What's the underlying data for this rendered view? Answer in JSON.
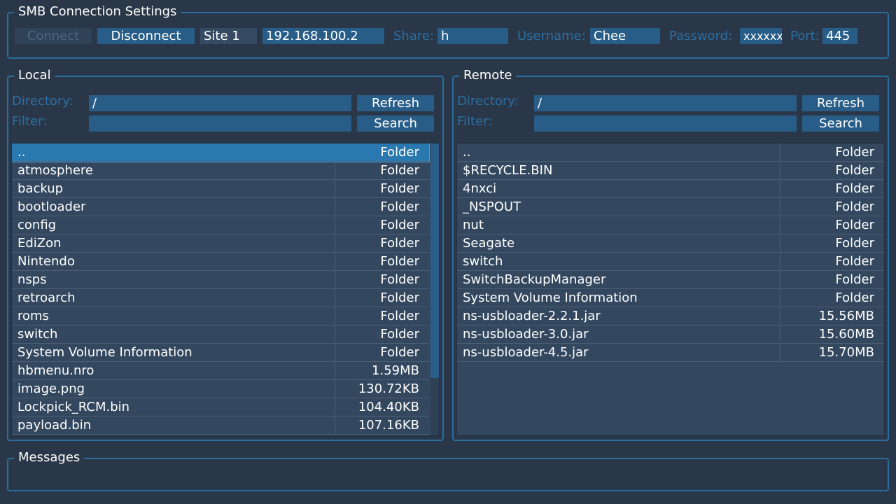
{
  "connection": {
    "title": "SMB Connection Settings",
    "connect_label": "Connect",
    "disconnect_label": "Disconnect",
    "site": "Site 1",
    "host": "192.168.100.2",
    "share_label": "Share:",
    "share": "h",
    "username_label": "Username:",
    "username": "Chee",
    "password_label": "Password:",
    "password": "xxxxxx",
    "port_label": "Port:",
    "port": "445"
  },
  "local": {
    "title": "Local",
    "directory_label": "Directory:",
    "directory": "/",
    "filter_label": "Filter:",
    "filter": "",
    "refresh_label": "Refresh",
    "search_label": "Search",
    "scroll_fraction_visible": 0.8,
    "files": [
      {
        "name": "..",
        "size": "Folder",
        "selected": true
      },
      {
        "name": "atmosphere",
        "size": "Folder"
      },
      {
        "name": "backup",
        "size": "Folder"
      },
      {
        "name": "bootloader",
        "size": "Folder"
      },
      {
        "name": "config",
        "size": "Folder"
      },
      {
        "name": "EdiZon",
        "size": "Folder"
      },
      {
        "name": "Nintendo",
        "size": "Folder"
      },
      {
        "name": "nsps",
        "size": "Folder"
      },
      {
        "name": "retroarch",
        "size": "Folder"
      },
      {
        "name": "roms",
        "size": "Folder"
      },
      {
        "name": "switch",
        "size": "Folder"
      },
      {
        "name": "System Volume Information",
        "size": "Folder"
      },
      {
        "name": "hbmenu.nro",
        "size": "1.59MB"
      },
      {
        "name": "image.png",
        "size": "130.72KB"
      },
      {
        "name": "Lockpick_RCM.bin",
        "size": "104.40KB"
      },
      {
        "name": "payload.bin",
        "size": "107.16KB"
      }
    ]
  },
  "remote": {
    "title": "Remote",
    "directory_label": "Directory:",
    "directory": "/",
    "filter_label": "Filter:",
    "filter": "",
    "refresh_label": "Refresh",
    "search_label": "Search",
    "files": [
      {
        "name": "..",
        "size": "Folder"
      },
      {
        "name": "$RECYCLE.BIN",
        "size": "Folder"
      },
      {
        "name": "4nxci",
        "size": "Folder"
      },
      {
        "name": "_NSPOUT",
        "size": "Folder"
      },
      {
        "name": "nut",
        "size": "Folder"
      },
      {
        "name": "Seagate",
        "size": "Folder"
      },
      {
        "name": "switch",
        "size": "Folder"
      },
      {
        "name": "SwitchBackupManager",
        "size": "Folder"
      },
      {
        "name": "System Volume Information",
        "size": "Folder"
      },
      {
        "name": "ns-usbloader-2.2.1.jar",
        "size": "15.56MB"
      },
      {
        "name": "ns-usbloader-3.0.jar",
        "size": "15.60MB"
      },
      {
        "name": "ns-usbloader-4.5.jar",
        "size": "15.70MB"
      }
    ]
  },
  "messages": {
    "title": "Messages",
    "text": ""
  }
}
